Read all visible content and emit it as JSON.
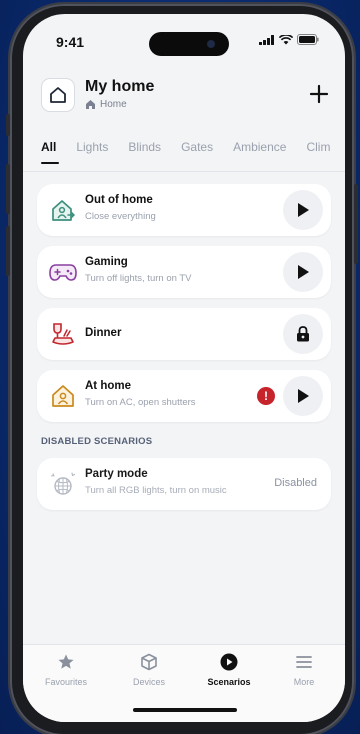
{
  "status_bar": {
    "time": "9:41"
  },
  "header": {
    "title": "My home",
    "subtitle": "Home"
  },
  "tabs": [
    {
      "label": "All",
      "active": true
    },
    {
      "label": "Lights"
    },
    {
      "label": "Blinds"
    },
    {
      "label": "Gates"
    },
    {
      "label": "Ambience"
    },
    {
      "label": "Clim"
    }
  ],
  "scenarios": [
    {
      "title": "Out of home",
      "subtitle": "Close everything",
      "icon": "leave-home-icon",
      "action": "play"
    },
    {
      "title": "Gaming",
      "subtitle": "Turn off lights, turn on TV",
      "icon": "gamepad-icon",
      "action": "play"
    },
    {
      "title": "Dinner",
      "subtitle": "",
      "icon": "wine-dinner-icon",
      "action": "locked"
    },
    {
      "title": "At home",
      "subtitle": "Turn on AC, open shutters",
      "icon": "home-person-icon",
      "action": "play",
      "warning": "!"
    }
  ],
  "disabled_section": {
    "title": "DISABLED SCENARIOS",
    "items": [
      {
        "title": "Party mode",
        "subtitle": "Turn all RGB lights, turn on music",
        "icon": "disco-ball-icon",
        "status": "Disabled"
      }
    ]
  },
  "bottom_nav": [
    {
      "label": "Favourites",
      "icon": "star-icon"
    },
    {
      "label": "Devices",
      "icon": "cube-icon"
    },
    {
      "label": "Scenarios",
      "icon": "play-circle-icon",
      "active": true
    },
    {
      "label": "More",
      "icon": "menu-icon"
    }
  ],
  "colors": {
    "background": "#0a2a6e",
    "screen": "#f3f4f6",
    "out_of_home_icon": "#3d8f7e",
    "gaming_icon": "#8a3fa0",
    "dinner_icon": "#c1272d",
    "at_home_icon": "#c98a1f",
    "warning": "#c7232b"
  }
}
